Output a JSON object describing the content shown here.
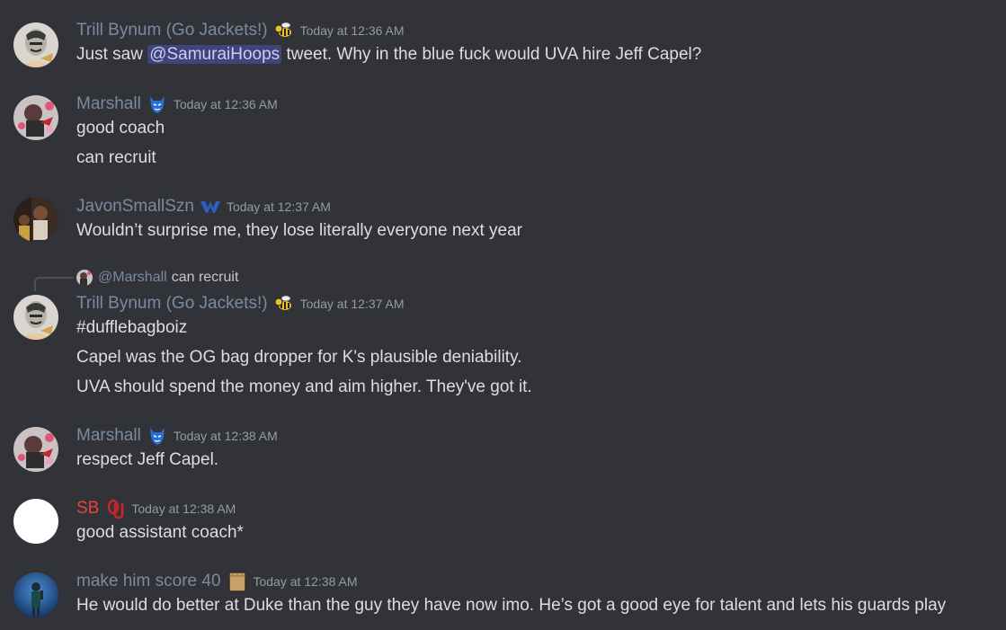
{
  "messages": [
    {
      "username": "Trill Bynum (Go Jackets!)",
      "badge": "yellow-jacket-icon",
      "timestamp": "Today at 12:36 AM",
      "lines": {
        "pre": "Just saw ",
        "mention": "@SamuraiHoops",
        "post": " tweet.  Why in the blue fuck would UVA hire Jeff Capel?"
      }
    },
    {
      "username": "Marshall",
      "badge": "blue-devil-icon",
      "timestamp": "Today at 12:36 AM",
      "lines": [
        "good coach",
        "can recruit"
      ]
    },
    {
      "username": "JavonSmallSzn",
      "badge": "wv-logo-icon",
      "timestamp": "Today at 12:37 AM",
      "lines": [
        "Wouldn’t surprise me, they lose literally everyone next year"
      ]
    },
    {
      "reply": {
        "user": "@Marshall",
        "text": "can recruit"
      },
      "username": "Trill Bynum (Go Jackets!)",
      "badge": "yellow-jacket-icon",
      "timestamp": "Today at 12:37 AM",
      "lines": [
        "#dufflebagboiz",
        "Capel was the OG bag dropper for K's plausible deniability.",
        "UVA should spend the money and aim higher.  They've got it."
      ]
    },
    {
      "username": "Marshall",
      "badge": "blue-devil-icon",
      "timestamp": "Today at 12:38 AM",
      "lines": [
        "respect Jeff Capel."
      ]
    },
    {
      "username": "SB",
      "badge": "ou-logo-icon",
      "timestamp": "Today at 12:38 AM",
      "lines": [
        "good assistant coach*"
      ]
    },
    {
      "username": "make him score 40",
      "badge": "paper-bag-icon",
      "timestamp": "Today at 12:38 AM",
      "lines": [
        "He would do better at Duke than the guy they have now imo. He’s got a good eye for talent and lets his guards play"
      ]
    }
  ],
  "colors": {
    "background": "#323339",
    "username": "#7a8b9f",
    "username_red": "#e8413f",
    "text": "#dbdee1",
    "timestamp": "#949ba4",
    "mention_bg": "#5865f2"
  }
}
